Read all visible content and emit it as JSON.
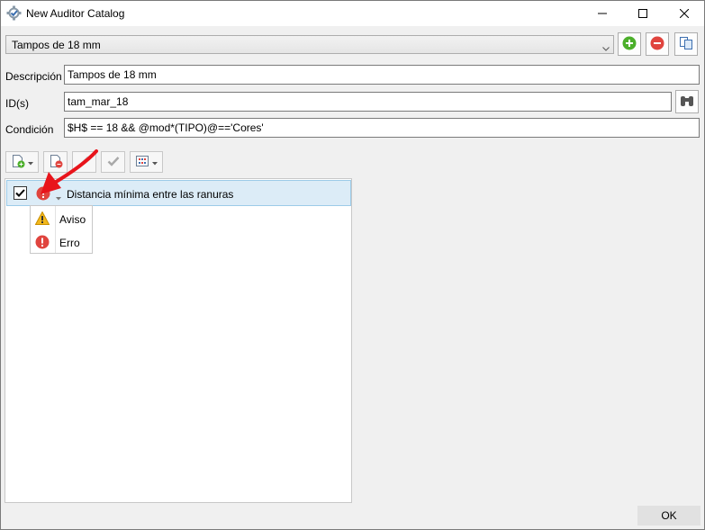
{
  "window": {
    "title": "New Auditor Catalog"
  },
  "catalog_select": {
    "value": "Tampos de 18 mm"
  },
  "form": {
    "descripcion_label": "Descripción",
    "descripcion_value": "Tampos de 18 mm",
    "ids_label": "ID(s)",
    "ids_value": "tam_mar_18",
    "condicion_label": "Condición",
    "condicion_value": "$H$ == 18 && @mod*(TIPO)@=='Cores'"
  },
  "rules": [
    {
      "checked": true,
      "severity": "error",
      "label": "Distancia mínima entre las ranuras"
    }
  ],
  "severity_menu": {
    "items": [
      {
        "label": "Aviso",
        "icon": "warning-icon"
      },
      {
        "label": "Erro",
        "icon": "error-icon"
      }
    ]
  },
  "footer": {
    "ok_label": "OK"
  },
  "colors": {
    "selection": "#dcecf7",
    "error": "#e0443e",
    "warning": "#f2b81c",
    "add": "#4caf2b",
    "annotation_arrow": "#e8141b"
  }
}
